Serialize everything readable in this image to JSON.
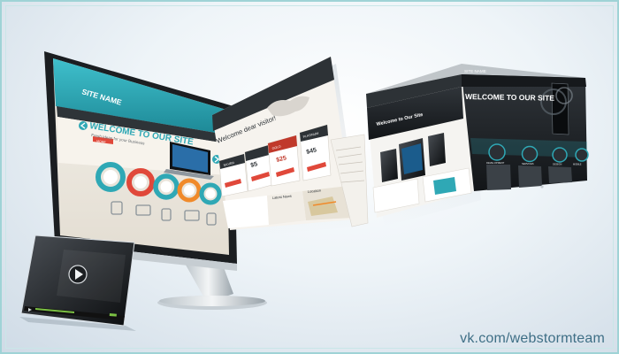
{
  "monitor_page": {
    "site_name": "SITE NAME",
    "headline": "WELCOME TO OUR SITE",
    "tagline": "Fresh Ideas for your Business",
    "button": "MORE"
  },
  "middle_page": {
    "greeting": "Welcome dear visitor!",
    "plans": [
      "SILVER",
      "GOLD",
      "PLATINUM"
    ],
    "prices": [
      "$5",
      "$25",
      "$45"
    ],
    "latest_news": "Latest News",
    "location": "Location"
  },
  "right_page": {
    "site_name": "SITE NAME",
    "headline": "WELCOME TO OUR SITE",
    "subheadline": "Welcome to Our Site",
    "features": [
      "DEVELOPMENT",
      "SERVICES",
      "DESIGN",
      "MOBILE"
    ]
  },
  "watermark": "vk.com/webstormteam",
  "colors": {
    "teal": "#2fa8b5",
    "dark": "#1f2326",
    "red": "#e0483a",
    "orange": "#f08a2a"
  }
}
